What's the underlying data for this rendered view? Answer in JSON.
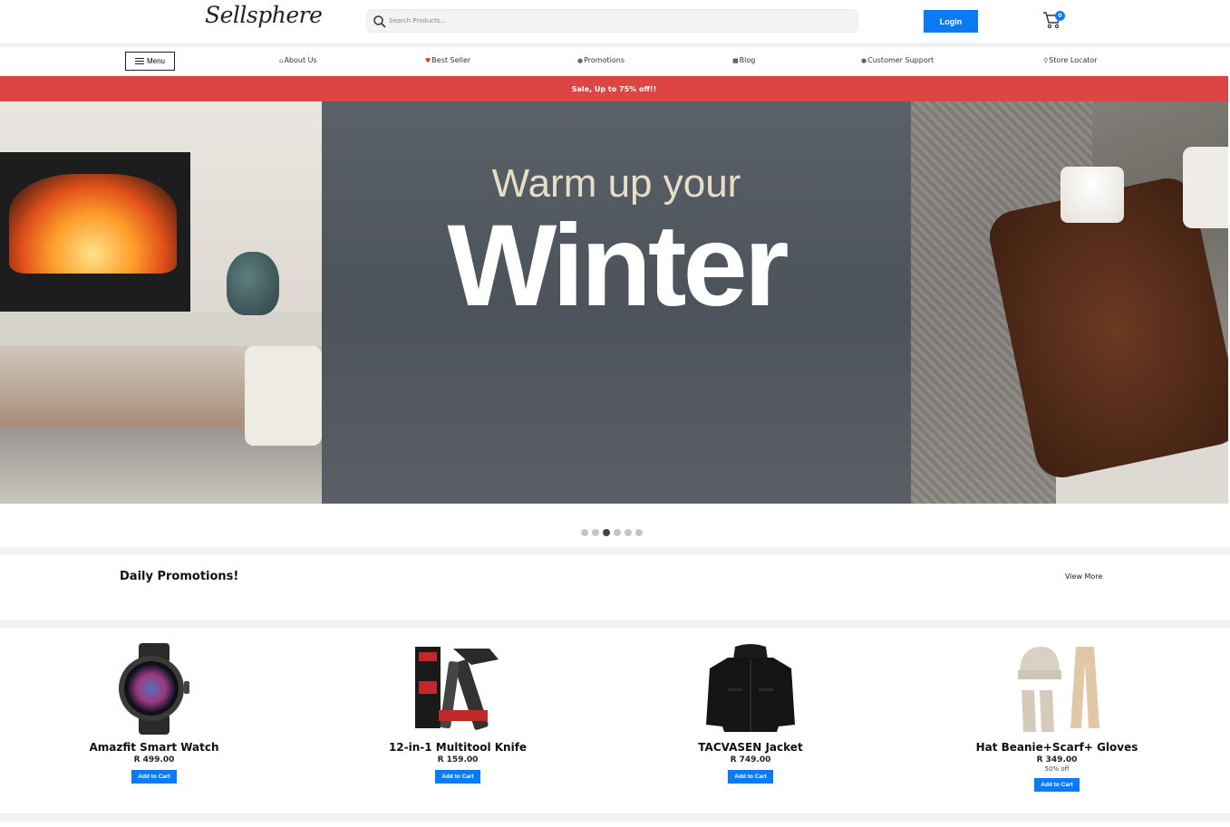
{
  "header": {
    "logo": "Sellsphere",
    "search_placeholder": "Search Products...",
    "login_label": "Login",
    "cart_count": "0"
  },
  "nav": {
    "menu_label": "Menu",
    "items": [
      {
        "label": "About Us",
        "icon": "home-icon"
      },
      {
        "label": "Best Seller",
        "icon": "heart-icon"
      },
      {
        "label": "Promotions",
        "icon": "tag-icon"
      },
      {
        "label": "Blog",
        "icon": "blog-icon"
      },
      {
        "label": "Customer Support",
        "icon": "chat-icon"
      },
      {
        "label": "Store Locator",
        "icon": "location-pin-icon"
      }
    ]
  },
  "sale_banner": "Sale, Up to 75% off!!",
  "hero": {
    "subtitle": "Warm up your",
    "title": "Winter",
    "slide_count": 6,
    "active_slide": 3
  },
  "promotions": {
    "title": "Daily Promotions!",
    "view_more": "View More"
  },
  "products": [
    {
      "name": "Amazfit Smart Watch",
      "price": "R 499.00",
      "discount": "",
      "button": "Add to Cart"
    },
    {
      "name": "12-in-1 Multitool Knife",
      "price": "R 159.00",
      "discount": "",
      "button": "Add to Cart"
    },
    {
      "name": "TACVASEN Jacket",
      "price": "R 749.00",
      "discount": "",
      "button": "Add to Cart"
    },
    {
      "name": "Hat Beanie+Scarf+ Gloves",
      "price": "R 349.00",
      "discount": "50% off",
      "button": "Add to Cart"
    }
  ],
  "colors": {
    "accent": "#0b7bf4",
    "sale_banner": "#dd4444"
  }
}
